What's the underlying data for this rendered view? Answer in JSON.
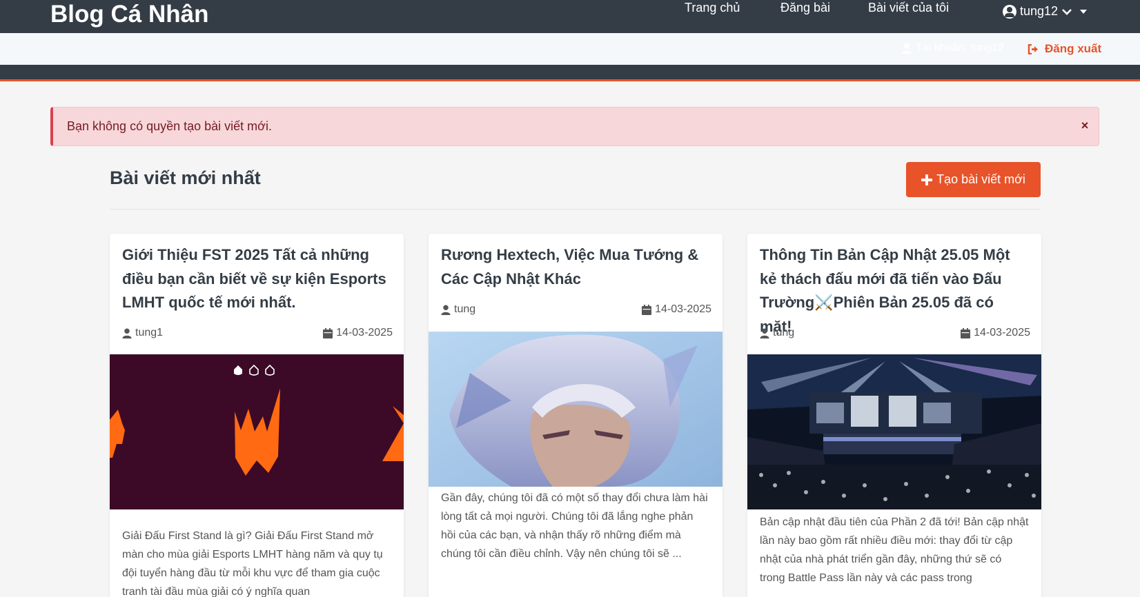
{
  "nav": {
    "brand": "Blog Cá Nhân",
    "links": [
      "Trang chủ",
      "Đăng bài",
      "Bài viết của tôi"
    ],
    "user": "tung12"
  },
  "subbar": {
    "account": "Tài khoản: tung12",
    "logout": "Đăng xuất"
  },
  "alert": {
    "message": "Bạn không có quyền tạo bài viết mới.",
    "close": "×"
  },
  "main": {
    "title": "Bài viết mới nhất",
    "create_button": "Tạo bài viết mới"
  },
  "posts": [
    {
      "title": "Giới Thiệu FST 2025 Tất cả những điều bạn cần biết về sự kiện Esports LMHT quốc tế mới nhất.",
      "author": "tung1",
      "date": "14-03-2025",
      "excerpt": "Giải Đấu First Stand là gì? Giải Đấu First Stand mở màn cho mùa giải Esports LMHT hàng năm và quy tụ đội tuyển hàng đầu từ mỗi khu vực để tham gia cuộc tranh tài đầu mùa giải có ý nghĩa quan"
    },
    {
      "title": "Rương Hextech, Việc Mua Tướng & Các Cập Nhật Khác",
      "author": "tung",
      "date": "14-03-2025",
      "excerpt": "Gần đây, chúng tôi đã có một số thay đổi chưa làm hài lòng tất cả mọi người. Chúng tôi đã lắng nghe phản hồi của các bạn, và nhận thấy rõ những điểm mà chúng tôi cần điều chỉnh. Vậy nên chúng tôi sẽ ..."
    },
    {
      "title": "Thông Tin Bản Cập Nhật 25.05 Một kẻ thách đấu mới đã tiến vào Đấu Trường⚔️Phiên Bản 25.05 đã có mặt!",
      "author": "tung",
      "date": "14-03-2025",
      "excerpt": "Bản cập nhật đầu tiên của Phần 2 đã tới! Bản cập nhật lần này bao gồm rất nhiều điều mới: thay đổi từ cập nhật của nhà phát triển gần đây, những thứ sẽ có trong Battle Pass lần này và các pass trong"
    }
  ],
  "colors": {
    "nav_bg": "#343d46",
    "accent": "#e8532a",
    "alert_bg": "#f8d7da",
    "alert_text": "#721c24"
  },
  "icons": [
    "user-circle-icon",
    "chevron-down-icon",
    "caret-down-icon",
    "user-icon",
    "logout-icon",
    "close-icon",
    "plus-icon",
    "calendar-icon"
  ]
}
